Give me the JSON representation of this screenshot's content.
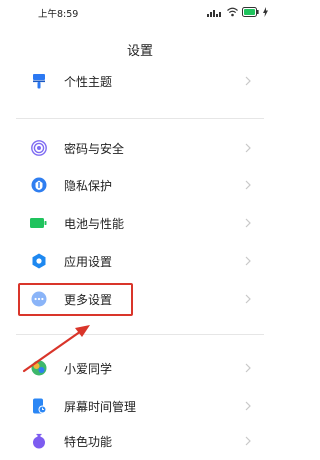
{
  "status_bar": {
    "time": "上午8:59"
  },
  "header": {
    "title": "设置"
  },
  "items": [
    {
      "label": "个性主题",
      "icon": "theme-icon",
      "color": "#2b78f2"
    },
    {
      "label": "密码与安全",
      "icon": "fingerprint-icon",
      "color": "#7e6cf2"
    },
    {
      "label": "隐私保护",
      "icon": "privacy-icon",
      "color": "#2f7ef0"
    },
    {
      "label": "电池与性能",
      "icon": "battery-icon",
      "color": "#1fc35d"
    },
    {
      "label": "应用设置",
      "icon": "gear-icon",
      "color": "#1e88f0"
    },
    {
      "label": "更多设置",
      "icon": "more-icon",
      "color": "#8ab4f8"
    },
    {
      "label": "小爱同学",
      "icon": "xiaoai-icon",
      "color": "#3db86b"
    },
    {
      "label": "屏幕时间管理",
      "icon": "screen-time-icon",
      "color": "#2a86f5"
    },
    {
      "label": "特色功能",
      "icon": "feature-icon",
      "color": "#7d5cf0"
    }
  ],
  "chevron": ">",
  "annotation": {
    "highlight_color": "#d9352a"
  }
}
